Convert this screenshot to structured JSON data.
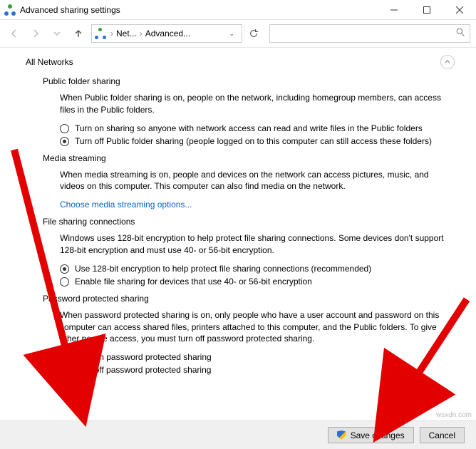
{
  "window": {
    "title": "Advanced sharing settings"
  },
  "breadcrumb": {
    "item1": "Net...",
    "item2": "Advanced..."
  },
  "profile": {
    "name": "All Networks"
  },
  "sections": {
    "publicFolder": {
      "title": "Public folder sharing",
      "desc": "When Public folder sharing is on, people on the network, including homegroup members, can access files in the Public folders.",
      "opt1": "Turn on sharing so anyone with network access can read and write files in the Public folders",
      "opt2": "Turn off Public folder sharing (people logged on to this computer can still access these folders)"
    },
    "media": {
      "title": "Media streaming",
      "desc": "When media streaming is on, people and devices on the network can access pictures, music, and videos on this computer. This computer can also find media on the network.",
      "link": "Choose media streaming options..."
    },
    "fileSharing": {
      "title": "File sharing connections",
      "desc": "Windows uses 128-bit encryption to help protect file sharing connections. Some devices don't support 128-bit encryption and must use 40- or 56-bit encryption.",
      "opt1": "Use 128-bit encryption to help protect file sharing connections (recommended)",
      "opt2": "Enable file sharing for devices that use 40- or 56-bit encryption"
    },
    "password": {
      "title": "Password protected sharing",
      "desc": "When password protected sharing is on, only people who have a user account and password on this computer can access shared files, printers attached to this computer, and the Public folders. To give other people access, you must turn off password protected sharing.",
      "opt1": "Turn on password protected sharing",
      "opt2": "Turn off password protected sharing"
    }
  },
  "buttons": {
    "save": "Save changes",
    "cancel": "Cancel"
  },
  "watermark": "wsxdn.com"
}
